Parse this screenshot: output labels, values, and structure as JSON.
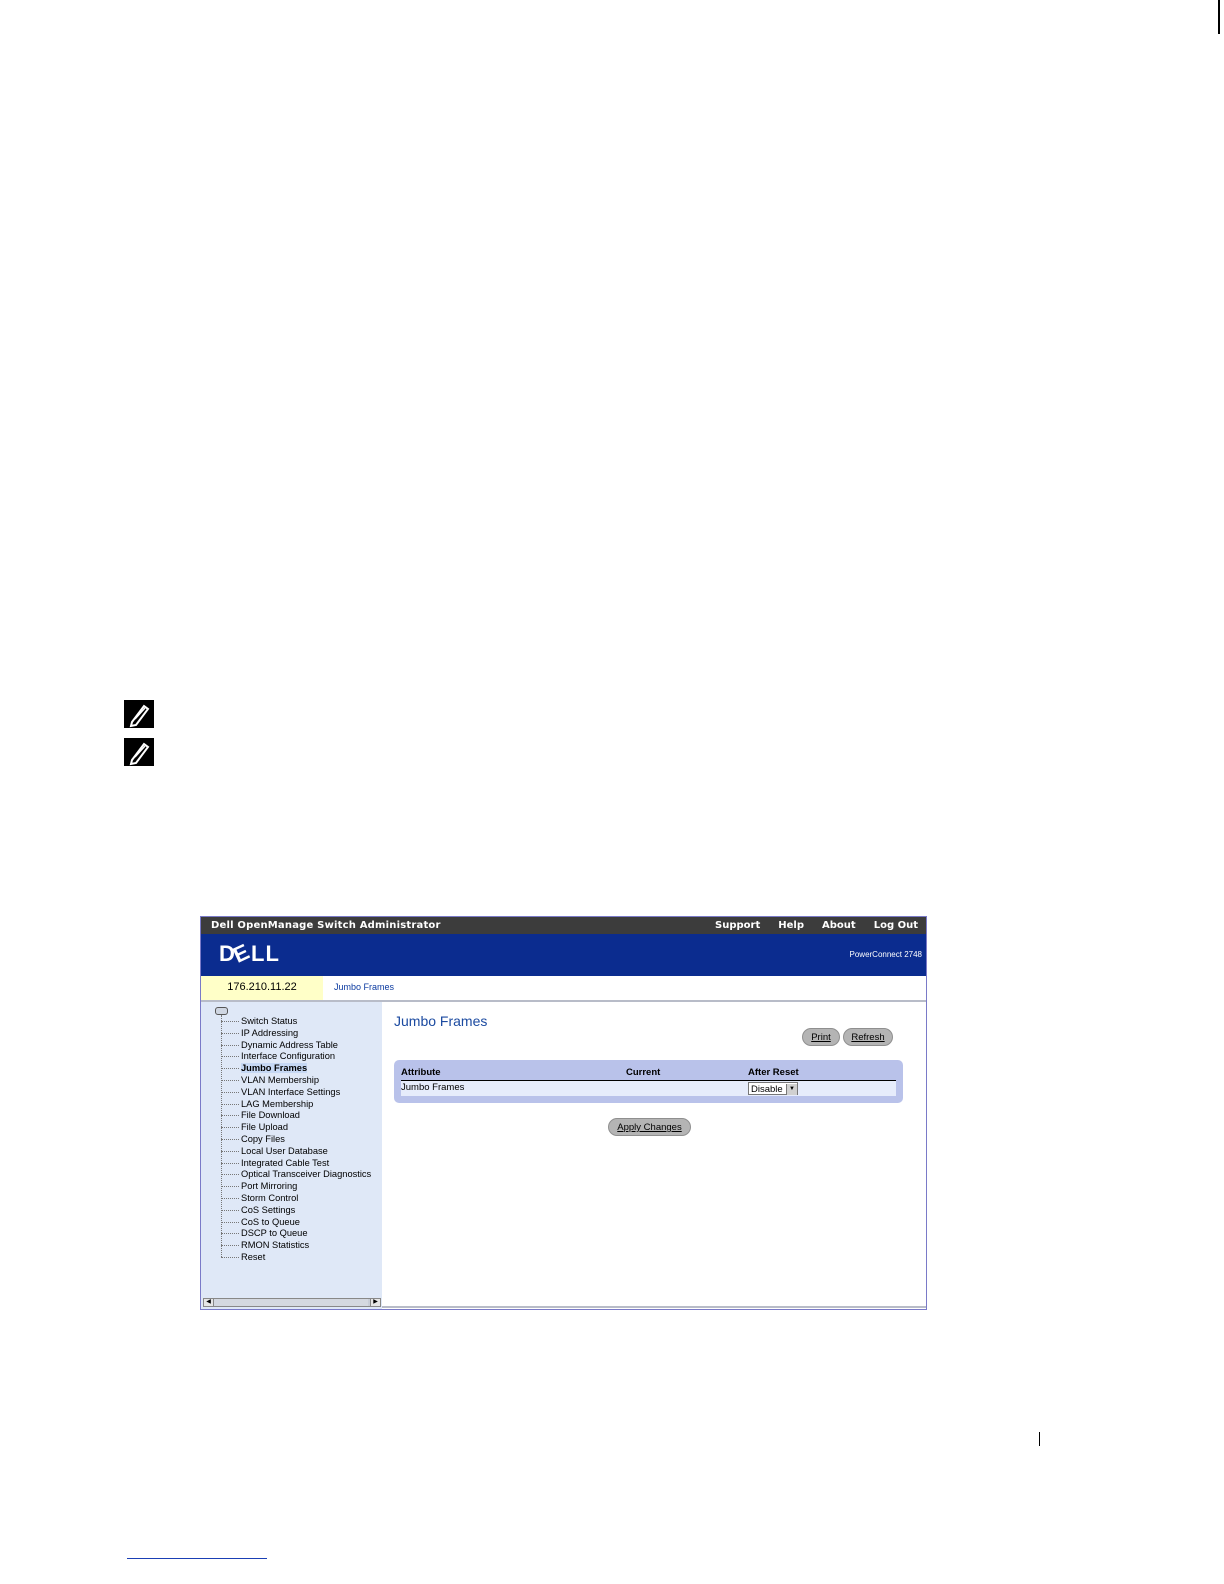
{
  "window": {
    "app_title": "Dell OpenManage Switch Administrator",
    "links": [
      "Support",
      "Help",
      "About",
      "Log Out"
    ],
    "model": "PowerConnect 2748",
    "ip_address": "176.210.11.22",
    "breadcrumb": "Jumbo Frames"
  },
  "sidebar": {
    "items": [
      "Switch Status",
      "IP Addressing",
      "Dynamic Address Table",
      "Interface Configuration",
      "Jumbo Frames",
      "VLAN Membership",
      "VLAN Interface Settings",
      "LAG Membership",
      "File Download",
      "File Upload",
      "Copy Files",
      "Local User Database",
      "Integrated Cable Test",
      "Optical Transceiver Diagnostics",
      "Port Mirroring",
      "Storm Control",
      "CoS Settings",
      "CoS to Queue",
      "DSCP to Queue",
      "RMON Statistics",
      "Reset"
    ],
    "active_item": "Jumbo Frames"
  },
  "main": {
    "title": "Jumbo Frames",
    "print_label": "Print",
    "refresh_label": "Refresh",
    "table": {
      "headers": [
        "Attribute",
        "Current",
        "After Reset"
      ],
      "row": {
        "attribute": "Jumbo Frames",
        "current": "",
        "after_reset": "Disable"
      }
    },
    "apply_label": "Apply Changes"
  },
  "icons": {
    "note": "note-pencil-icon",
    "logo": "dell-logo"
  },
  "colors": {
    "brand_blue": "#0b2c8f",
    "title_bar": "#3c3c3c",
    "ip_highlight": "#ffffc8",
    "sidebar_bg": "#dfe8f7",
    "table_bg": "#b9c2ea"
  }
}
